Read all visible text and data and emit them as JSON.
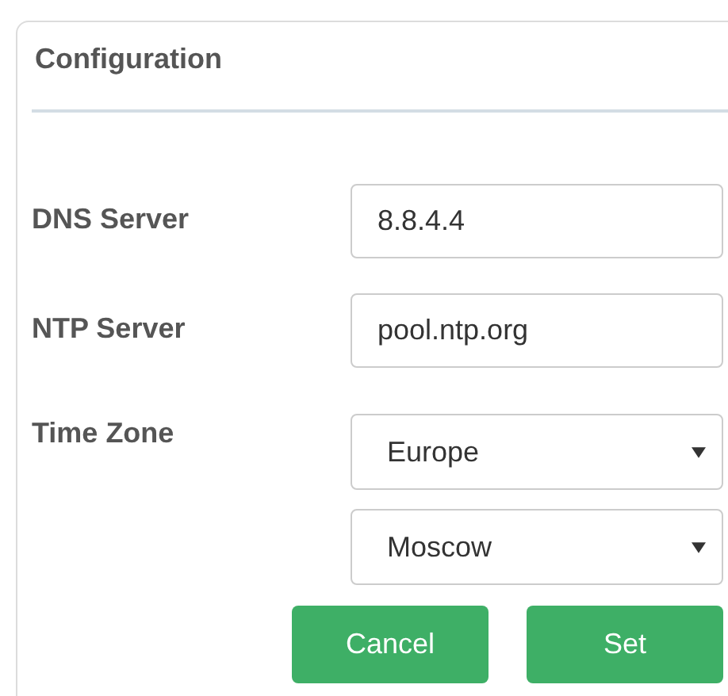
{
  "panel": {
    "title": "Configuration"
  },
  "fields": [
    {
      "kind": "text",
      "label": "DNS Server",
      "value": "8.8.4.4"
    },
    {
      "kind": "text",
      "label": "NTP Server",
      "value": "pool.ntp.org"
    },
    {
      "kind": "select",
      "label": "Time Zone",
      "values": [
        "Europe",
        "Moscow"
      ]
    }
  ],
  "buttons": [
    "Cancel",
    "Set"
  ]
}
